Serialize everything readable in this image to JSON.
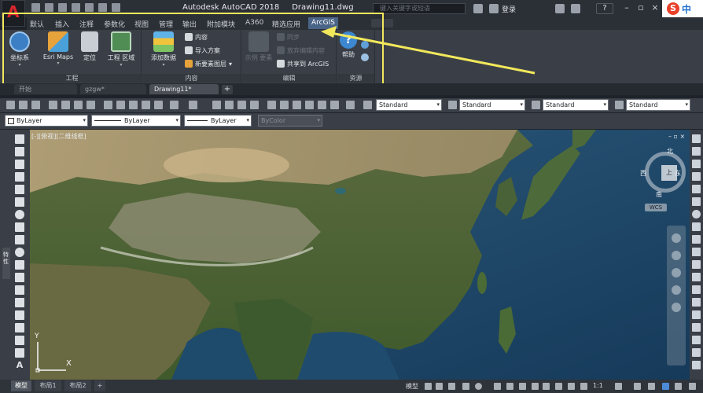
{
  "titlebar": {
    "app_name": "Autodesk AutoCAD 2018",
    "doc_name": "Drawing11.dwg",
    "search_placeholder": "键入关键字或短语",
    "login_label": "登录",
    "help_label": "?",
    "brand_s": "S",
    "brand_zh": "中"
  },
  "ribbon_tabs": [
    "默认",
    "插入",
    "注释",
    "参数化",
    "视图",
    "管理",
    "输出",
    "附加模块",
    "A360",
    "精选应用",
    "ArcGIS"
  ],
  "ribbon_active_tab": "ArcGIS",
  "ribbon": {
    "groups": {
      "project": "工程",
      "content": "内容",
      "edit": "编辑",
      "resources": "资源"
    },
    "project": {
      "coord_sys": "坐标系",
      "esri_maps": "Esri Maps",
      "locate": "定位",
      "project_area": "工程 区域"
    },
    "content": {
      "add_data": "添加数据",
      "content": "内容",
      "import_scheme": "导入方案",
      "new_feature_layer": "新要素图层"
    },
    "edit": {
      "feature_edit": "示例 要素",
      "sync": "同步",
      "discard": "放弃编辑内容",
      "share": "共享到 ArcGIS"
    },
    "resources": {
      "help": "帮助"
    }
  },
  "doc_tabs": [
    "开始",
    "gzgw*",
    "Drawing11*"
  ],
  "doc_active_tab": "Drawing11*",
  "toolbar1": {
    "combo_text_style": "Standard",
    "combo_dim_style": "Standard",
    "combo_table_style": "Standard",
    "combo_mleader_style": "Standard"
  },
  "toolbar2": {
    "layer": "ByLayer",
    "linetype": "ByLayer",
    "lineweight": "ByLayer",
    "color": "ByColor"
  },
  "left_panel_label": "特性",
  "viewport": {
    "label": "[-][俯视][二维线框]",
    "controls": "– ▫ ×",
    "compass": {
      "n": "北",
      "s": "南",
      "e": "东",
      "w": "西",
      "top": "上"
    },
    "wcs": "WCS",
    "ucs_x": "X",
    "ucs_y": "Y"
  },
  "bottom": {
    "tabs": [
      "模型",
      "布局1",
      "布局2"
    ],
    "active_tab": "模型",
    "model_label": "模型",
    "scale": "1:1"
  },
  "colors": {
    "highlight": "#f2e85c",
    "active_tab": "#4a6487"
  }
}
